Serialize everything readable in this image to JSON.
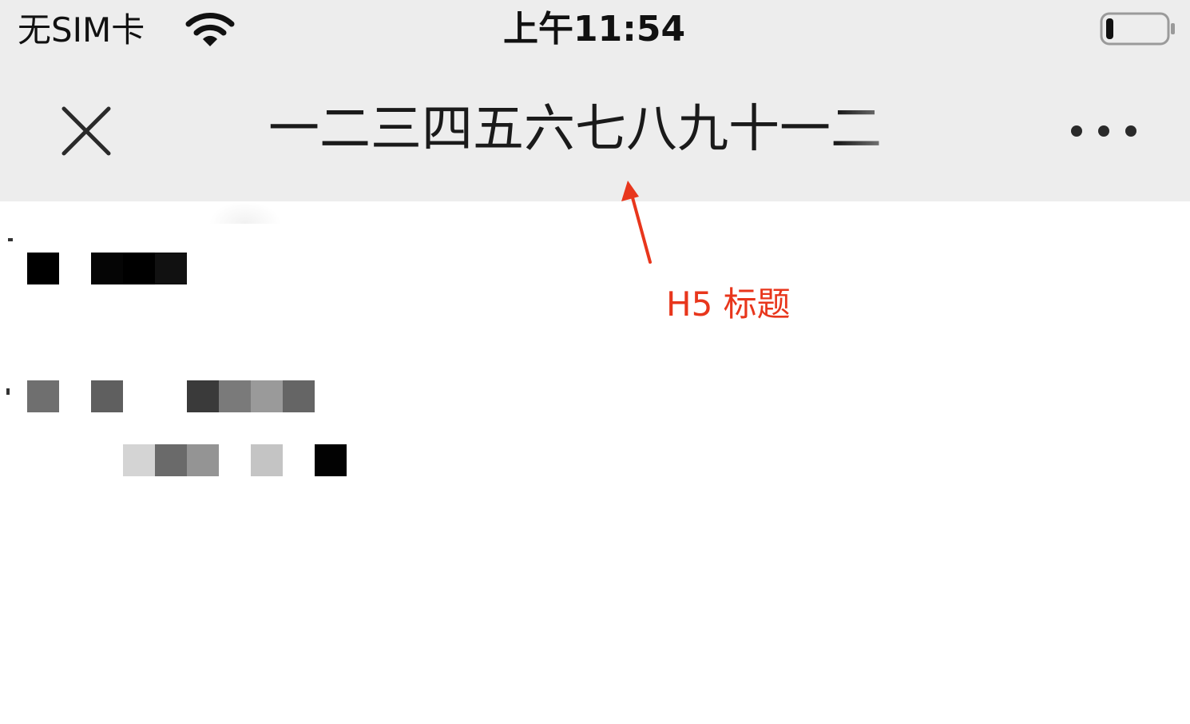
{
  "status_bar": {
    "carrier": "无SIM卡",
    "time": "上午11:54",
    "wifi_icon": "wifi-icon",
    "battery_icon": "battery-low-icon",
    "battery_level": 0.12
  },
  "nav_bar": {
    "title": "一二三四五六七八九十一二",
    "close_icon": "close-icon",
    "more_icon": "more-dots-icon"
  },
  "annotation": {
    "label": "H5 标题",
    "color": "#e8361c"
  },
  "colors": {
    "bar_background": "#ededed",
    "content_background": "#ffffff",
    "annotation": "#e8361c"
  }
}
